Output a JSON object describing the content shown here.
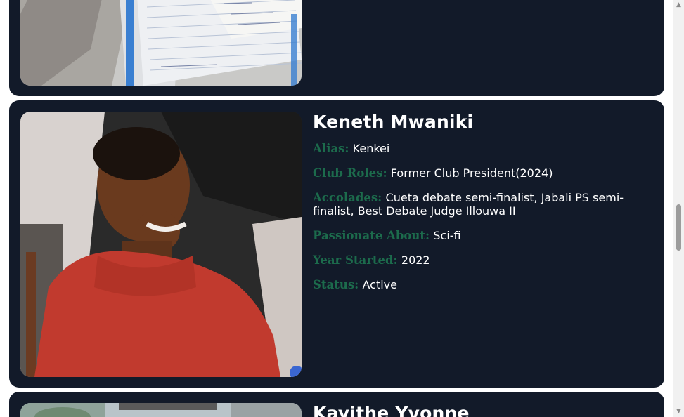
{
  "members": [
    {
      "name": "",
      "photo_icon": "notebook-papers-photo"
    },
    {
      "name": "Keneth Mwaniki",
      "photo_icon": "member-portrait-photo",
      "fields": [
        {
          "label": "Alias:",
          "value": "Kenkei"
        },
        {
          "label": "Club Roles:",
          "value": "Former Club President(2024)"
        },
        {
          "label": "Accolades:",
          "value": "Cueta debate semi-finalist, Jabali PS semi-finalist, Best Debate Judge Illouwa II"
        },
        {
          "label": "Passionate About:",
          "value": "Sci-fi"
        },
        {
          "label": "Year Started:",
          "value": "2022"
        },
        {
          "label": "Status:",
          "value": "Active"
        }
      ]
    },
    {
      "name": "Kayithe Yvonne",
      "photo_icon": "member-outdoor-photo"
    }
  ],
  "colors": {
    "card_bg": "#121a29",
    "label_green": "#1c6b4c",
    "text": "#ffffff",
    "page_bg": "#ffffff"
  },
  "scrollbar": {
    "up_icon": "scroll-up-arrow-icon",
    "down_icon": "scroll-down-arrow-icon"
  }
}
